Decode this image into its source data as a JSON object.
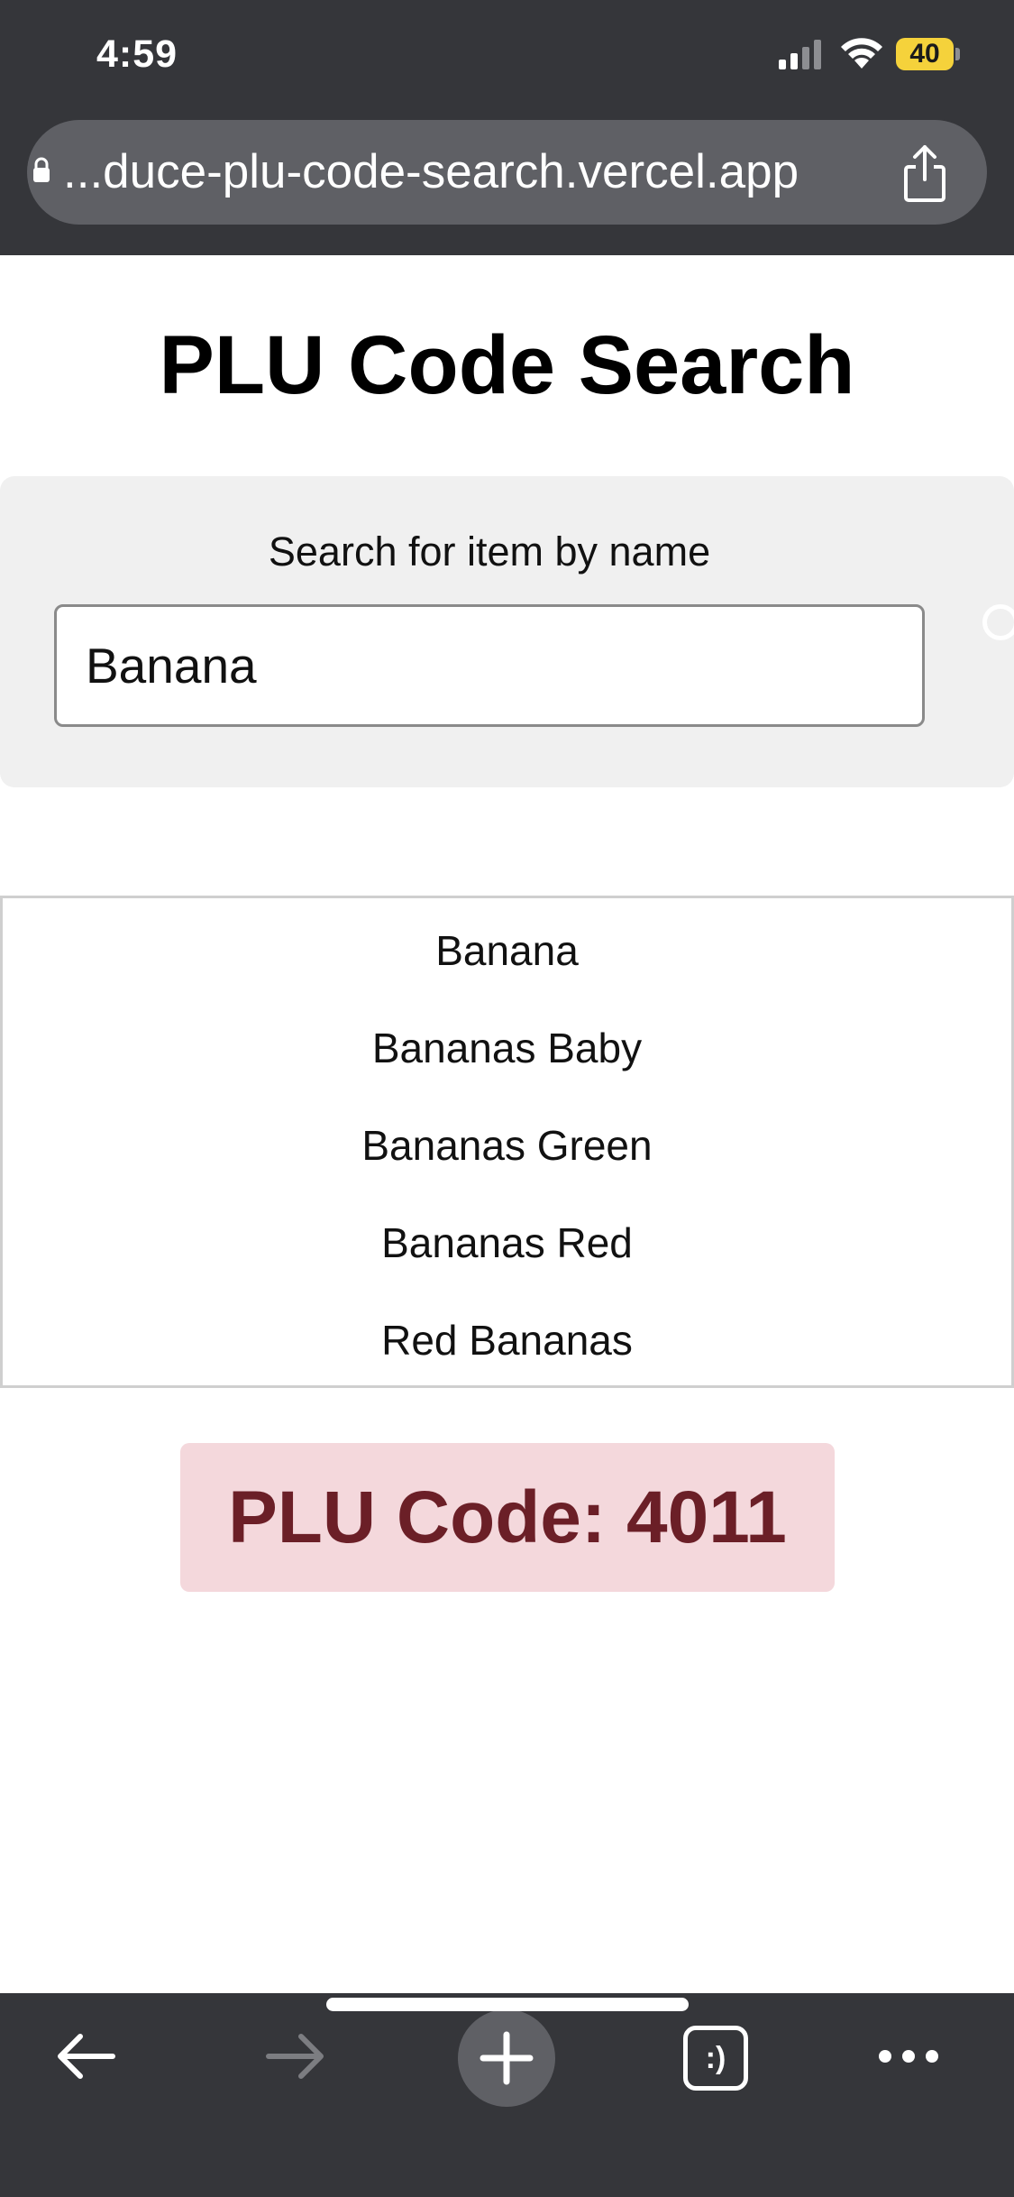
{
  "status_bar": {
    "time": "4:59",
    "battery_level": "40",
    "battery_color": "#f5d23b"
  },
  "browser": {
    "url_display": "...duce-plu-code-search.vercel.app",
    "chrome_color": "#35363a",
    "url_bar_color": "#5f6065"
  },
  "page": {
    "title": "PLU Code Search"
  },
  "search": {
    "label": "Search for item by name",
    "value": "Banana",
    "panel_color": "#f0f0f0"
  },
  "results": [
    {
      "label": "Banana"
    },
    {
      "label": "Bananas Baby"
    },
    {
      "label": "Bananas Green"
    },
    {
      "label": "Bananas Red"
    },
    {
      "label": "Red Bananas"
    }
  ],
  "plu": {
    "text": "PLU Code: 4011",
    "background_color": "#f4d8dc",
    "text_color": "#6b1f27"
  },
  "toolbar": {
    "tabs_label": ":)",
    "icons": [
      "back-arrow-icon",
      "forward-arrow-icon",
      "plus-icon",
      "tabs-icon",
      "more-icon"
    ]
  }
}
